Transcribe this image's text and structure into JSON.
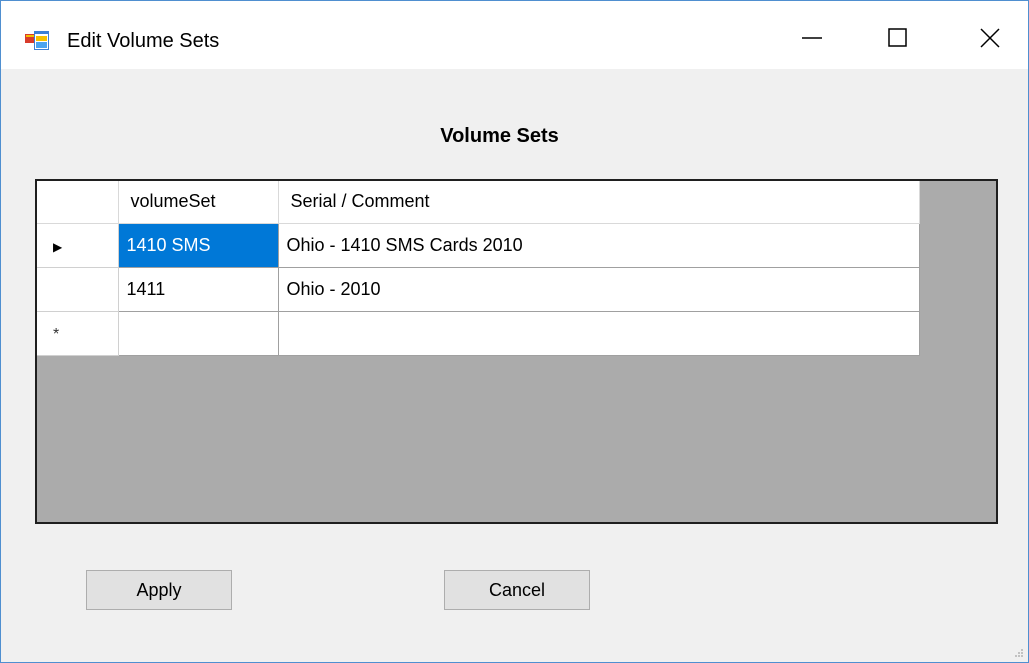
{
  "window": {
    "title": "Edit Volume Sets",
    "icon": "application-icon"
  },
  "title_controls": {
    "minimize": "minimize-icon",
    "maximize": "maximize-icon",
    "close": "close-icon"
  },
  "heading": "Volume Sets",
  "grid": {
    "columns": [
      "volumeSet",
      "Serial / Comment"
    ],
    "rows": [
      {
        "indicator": "▶",
        "volumeSet": "1410 SMS",
        "comment": "Ohio - 1410 SMS Cards 2010"
      },
      {
        "indicator": "",
        "volumeSet": "1411",
        "comment": "Ohio - 2010"
      },
      {
        "indicator": "*",
        "volumeSet": "",
        "comment": ""
      }
    ],
    "selection_color": "#0078d7"
  },
  "buttons": {
    "apply": "Apply",
    "cancel": "Cancel"
  }
}
